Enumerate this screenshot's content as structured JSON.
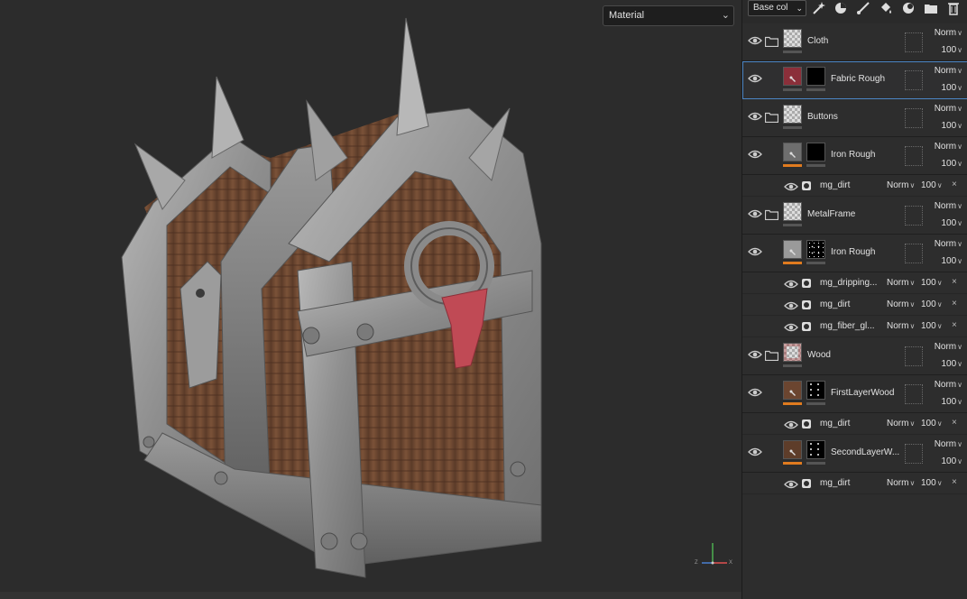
{
  "viewport": {
    "channel_select": "Material",
    "gizmo_labels": {
      "z": "Z",
      "x": "X"
    }
  },
  "toolbar": {
    "blend_mode": "Base col",
    "tools": [
      "magic-wand-icon",
      "smart-material-icon",
      "paint-brush-icon",
      "fill-bucket-icon",
      "mask-icon",
      "new-folder-icon",
      "delete-icon"
    ]
  },
  "layers": [
    {
      "kind": "folder",
      "name": "Cloth",
      "blend": "Norm",
      "opacity": "100",
      "thumb": "checker"
    },
    {
      "kind": "layer",
      "name": "Fabric Rough",
      "blend": "Norm",
      "opacity": "100",
      "thumb_color": "#8b2f3a",
      "mask": "black",
      "selected": true
    },
    {
      "kind": "folder",
      "name": "Buttons",
      "blend": "Norm",
      "opacity": "100",
      "thumb": "checker"
    },
    {
      "kind": "layer",
      "name": "Iron Rough",
      "blend": "Norm",
      "opacity": "100",
      "thumb_color": "#6e6e6e",
      "mask": "black",
      "bar": "orange",
      "masks": [
        {
          "name": "mg_dirt",
          "blend": "Norm",
          "opacity": "100"
        }
      ]
    },
    {
      "kind": "folder",
      "name": "MetalFrame",
      "blend": "Norm",
      "opacity": "100",
      "thumb": "checker"
    },
    {
      "kind": "layer",
      "name": "Iron Rough",
      "blend": "Norm",
      "opacity": "100",
      "thumb_color": "#9a9a9a",
      "mask": "noise",
      "bar": "orange",
      "masks": [
        {
          "name": "mg_dripping...",
          "blend": "Norm",
          "opacity": "100"
        },
        {
          "name": "mg_dirt",
          "blend": "Norm",
          "opacity": "100"
        },
        {
          "name": "mg_fiber_gl...",
          "blend": "Norm",
          "opacity": "100"
        }
      ]
    },
    {
      "kind": "folder",
      "name": "Wood",
      "blend": "Norm",
      "opacity": "100",
      "thumb": "checker-red"
    },
    {
      "kind": "layer",
      "name": "FirstLayerWood",
      "blend": "Norm",
      "opacity": "100",
      "thumb_color": "#6b4530",
      "mask": "spots",
      "bar": "orange",
      "masks": [
        {
          "name": "mg_dirt",
          "blend": "Norm",
          "opacity": "100"
        }
      ]
    },
    {
      "kind": "layer",
      "name": "SecondLayerW...",
      "blend": "Norm",
      "opacity": "100",
      "thumb_color": "#5e3d2a",
      "mask": "spots",
      "bar": "orange",
      "masks": [
        {
          "name": "mg_dirt",
          "blend": "Norm",
          "opacity": "100"
        }
      ]
    }
  ],
  "colors": {
    "accent_selected": "#4c86c6",
    "layer_bar": "#e07b1f",
    "panel_bg": "#2d2d2d",
    "viewport_bg": "#2c2c2c"
  }
}
